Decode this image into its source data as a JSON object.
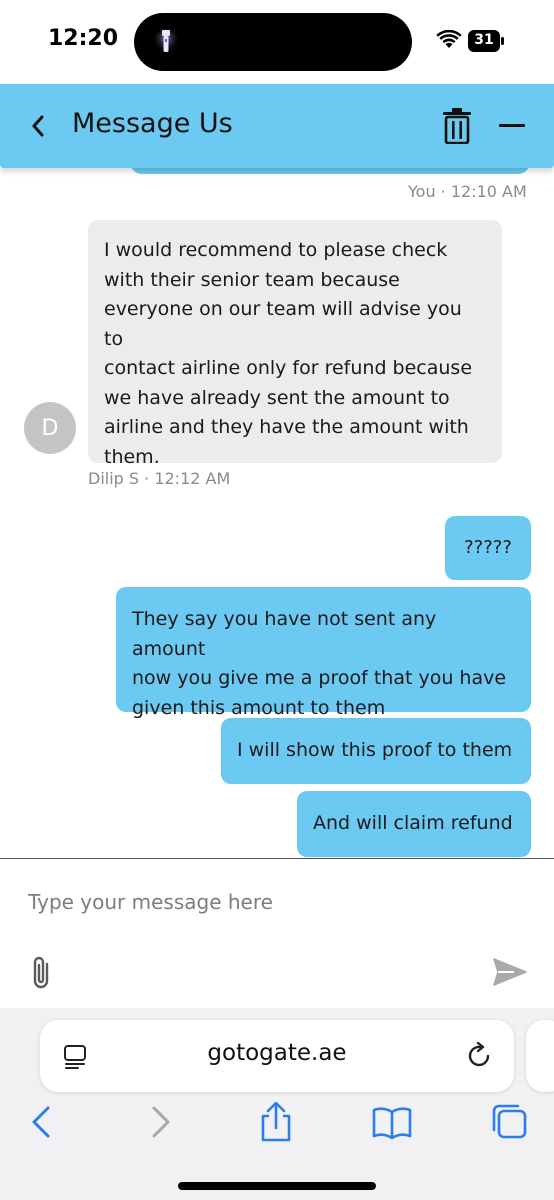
{
  "status_bar": {
    "time": "12:20",
    "battery_level": "31",
    "icons": [
      "flashlight-icon",
      "wifi-icon",
      "battery-icon"
    ]
  },
  "header": {
    "title": "Message Us",
    "icons": [
      "back-chevron-icon",
      "trash-icon",
      "minimize-icon"
    ],
    "background_color": "#6cc9f2"
  },
  "chat": {
    "messages": [
      {
        "sender": "agent",
        "avatar_initial": "D",
        "lines": [
          "I would recommend to please check",
          "with their senior team because",
          "everyone on our team will advise you to",
          "contact airline only for refund because",
          "we have already sent the amount to",
          "airline and they have the amount with",
          "them."
        ],
        "meta": "Dilip S · 12:12 AM"
      },
      {
        "sender": "user",
        "lines": [
          "?????"
        ]
      },
      {
        "sender": "user",
        "lines": [
          "They say you have not sent any amount",
          "now you give me a proof that you have",
          "given this amount to them"
        ]
      },
      {
        "sender": "user",
        "lines": [
          "I will show this proof to them"
        ]
      },
      {
        "sender": "user",
        "lines": [
          "And will claim refund"
        ]
      }
    ],
    "previous_meta": "You · 12:10 AM",
    "user_bubble_color": "#6cc9f2",
    "agent_bubble_color": "#ececec"
  },
  "composer": {
    "placeholder": "Type your message here",
    "value": "",
    "icons": [
      "paperclip-icon",
      "send-icon"
    ]
  },
  "browser": {
    "url": "gotogate.ae",
    "icons": [
      "page-menu-icon",
      "reload-icon",
      "back-icon",
      "forward-icon",
      "share-icon",
      "bookmarks-icon",
      "tabs-icon"
    ]
  }
}
